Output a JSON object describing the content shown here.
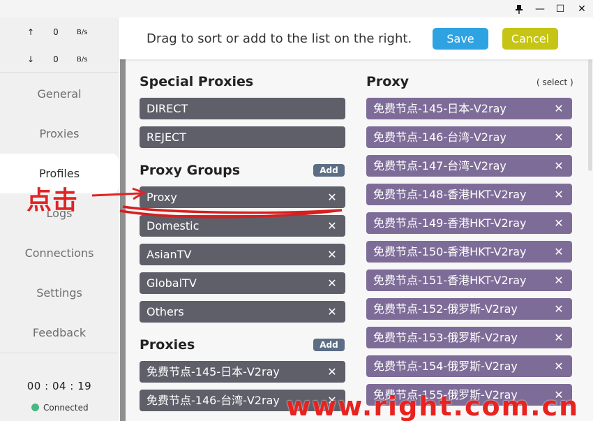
{
  "window": {
    "pin_icon": "pin-icon",
    "minimize": "—",
    "maximize": "☐",
    "close": "✕"
  },
  "traffic": {
    "up_arrow": "↑",
    "up_value": "0",
    "up_unit": "B/s",
    "down_arrow": "↓",
    "down_value": "0",
    "down_unit": "B/s"
  },
  "sidebar": {
    "items": [
      {
        "label": "General"
      },
      {
        "label": "Proxies"
      },
      {
        "label": "Profiles"
      },
      {
        "label": "Logs"
      },
      {
        "label": "Connections"
      },
      {
        "label": "Settings"
      },
      {
        "label": "Feedback"
      }
    ],
    "active": "Profiles",
    "clock": "00 : 04 : 19",
    "status": "Connected",
    "status_color": "#47b881"
  },
  "header": {
    "instruction": "Drag to sort or add to the list on the right.",
    "save_label": "Save",
    "cancel_label": "Cancel",
    "save_color": "#2fa3e2",
    "cancel_color": "#c6c414"
  },
  "left": {
    "special_title": "Special Proxies",
    "special": [
      "DIRECT",
      "REJECT"
    ],
    "groups_title": "Proxy Groups",
    "groups_add": "Add",
    "groups": [
      "Proxy",
      "Domestic",
      "AsianTV",
      "GlobalTV",
      "Others"
    ],
    "proxies_title": "Proxies",
    "proxies_add": "Add",
    "proxies": [
      "免费节点-145-日本-V2ray",
      "免费节点-146-台湾-V2ray"
    ]
  },
  "right": {
    "title": "Proxy",
    "type": "( select )",
    "items": [
      "免费节点-145-日本-V2ray",
      "免费节点-146-台湾-V2ray",
      "免费节点-147-台湾-V2ray",
      "免费节点-148-香港HKT-V2ray",
      "免费节点-149-香港HKT-V2ray",
      "免费节点-150-香港HKT-V2ray",
      "免费节点-151-香港HKT-V2ray",
      "免费节点-152-俄罗斯-V2ray",
      "免费节点-153-俄罗斯-V2ray",
      "免费节点-154-俄罗斯-V2ray",
      "免费节点-155-俄罗斯-V2ray"
    ]
  },
  "remove_glyph": "✕",
  "annotation": {
    "label": "点击",
    "color": "#e02424"
  },
  "watermark": "www.right.com.cn"
}
